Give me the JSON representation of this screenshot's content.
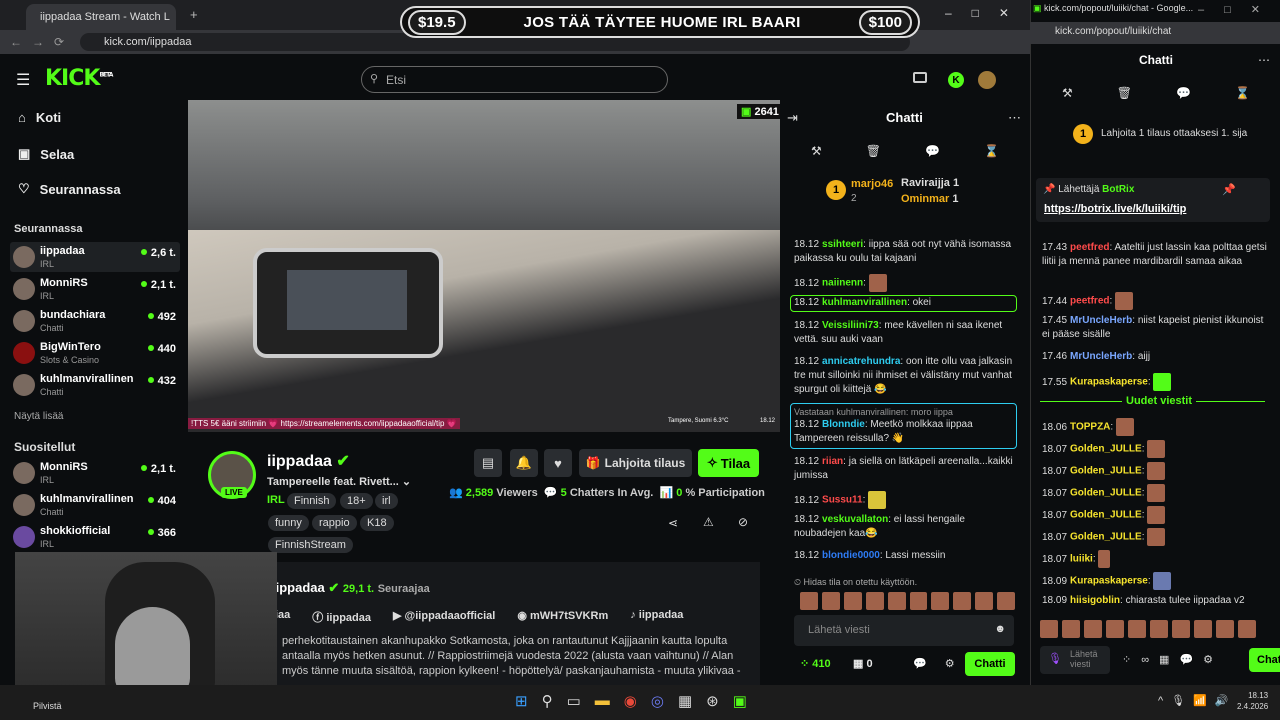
{
  "browser": {
    "tab_title": "iippadaa Stream - Watch L",
    "url": "kick.com/iippadaa",
    "popout_tab": "kick.com/popout/luiiki/chat - Google...",
    "popout_url": "kick.com/popout/luiiki/chat"
  },
  "banner": {
    "left": "$19.5",
    "text": "JOS TÄÄ TÄYTEE HUOME IRL BAARI",
    "right": "$100"
  },
  "logo": "KICK",
  "logo_beta": "BETA",
  "search": {
    "placeholder": "Etsi"
  },
  "nav": [
    {
      "label": "Koti"
    },
    {
      "label": "Selaa"
    },
    {
      "label": "Seurannassa"
    }
  ],
  "following_title": "Seurannassa",
  "following": [
    {
      "name": "iippadaa",
      "cat": "IRL",
      "viewers": "2,6 t."
    },
    {
      "name": "MonniRS",
      "cat": "IRL",
      "viewers": "2,1 t."
    },
    {
      "name": "bundachiara",
      "cat": "Chatti",
      "viewers": "492"
    },
    {
      "name": "BigWinTero",
      "cat": "Slots & Casino",
      "viewers": "440"
    },
    {
      "name": "kuhlmanvirallinen",
      "cat": "Chatti",
      "viewers": "432"
    }
  ],
  "show_all": "Näytä lisää",
  "recommended_title": "Suositellut",
  "recommended": [
    {
      "name": "MonniRS",
      "cat": "IRL",
      "viewers": "2,1 t."
    },
    {
      "name": "kuhlmanvirallinen",
      "cat": "Chatti",
      "viewers": "404"
    },
    {
      "name": "shokkiofficial",
      "cat": "IRL",
      "viewers": "366"
    }
  ],
  "video": {
    "viewers": "2641",
    "tts": "!TTS 5€ ääni striimiin 💗 https://streamelements.com/iippadaaofficial/tip 💗",
    "loc": "Tampere, Suomi  6.3°C",
    "time": "18.12"
  },
  "stream": {
    "name": "iippadaa",
    "title": "Tampereelle feat. Rivett...",
    "live": "LIVE",
    "category": "IRL",
    "tags": [
      "Finnish",
      "18+",
      "irl",
      "funny",
      "rappio",
      "K18",
      "FinnishStream"
    ],
    "gift": "Lahjoita tilaus",
    "sub": "Tilaa",
    "viewers": "2,589",
    "viewers_lbl": "Viewers",
    "chatters": "5",
    "chatters_lbl": "Chatters In Avg.",
    "part": "0",
    "part_lbl": "% Participation"
  },
  "about": {
    "name": "iippadaa",
    "followers": "29,1 t.",
    "followers_lbl": "Seuraajaa",
    "links": [
      "iaa",
      "iippadaa",
      "@iippadaaofficial",
      "mWH7tSVKRm",
      "iippadaa"
    ],
    "desc1": "perhekotitaustainen akanhupakko Sotkamosta, joka on rantautunut Kajjjaanin kautta lopulta",
    "desc2": "antaalla myös hetken asunut. // Rappiostriimejä vuodesta 2022 (alusta vaan vaihtunu) // Alan",
    "desc3": "myös tänne muuta sisältöä, rappion kylkeen! - höpöttelyä/ paskanjauhamista - muuta ylikivaa -"
  },
  "chat": {
    "title": "Chatti",
    "top": [
      {
        "rank": "1",
        "name": "marjo46",
        "n": "2"
      },
      {
        "name": "Raviraijja",
        "n": "1"
      },
      {
        "name": "Ominmar",
        "n": "1"
      }
    ],
    "messages": [
      {
        "t": "18.12",
        "u": "ssihteeri",
        "c": "#53fc18",
        "m": "iippa sää oot nyt vähä isomassa paikassa ku oulu tai kajaani"
      },
      {
        "t": "18.12",
        "u": "naiinenn",
        "c": "#53fc18",
        "m": ""
      },
      {
        "t": "18.12",
        "u": "kuhlmanvirallinen",
        "c": "#53fc18",
        "m": "okei"
      },
      {
        "t": "18.12",
        "u": "Veissiliini73",
        "c": "#53fc18",
        "m": "mee kävellen ni saa ikenet vettä. suu auki vaan"
      },
      {
        "t": "18.12",
        "u": "annicatrehundra",
        "c": "#2ecdf0",
        "m": "oon itte ollu vaa jalkasin tre mut silloinki nii ihmiset ei välistäny mut vanhat spurgut oli kiittejä 😂"
      },
      {
        "t": "18.12",
        "u": "Blonndie",
        "c": "#2ecdf0",
        "m": "Meetkö molkkaa iippaa Tampereen reissulla? 👋",
        "reply": "Vastataan kuhlmanvirallinen: moro iippa"
      },
      {
        "t": "18.12",
        "u": "riian",
        "c": "#ff4b4b",
        "m": "ja siellä on lätkäpeli areenalla...kaikki jumissa"
      },
      {
        "t": "18.12",
        "u": "Sussu11",
        "c": "#ff4b4b",
        "m": ""
      },
      {
        "t": "18.12",
        "u": "veskuvallaton",
        "c": "#53fc18",
        "m": "ei lassi hengaile noubadejen kaa😂"
      },
      {
        "t": "18.12",
        "u": "blondie0000",
        "c": "#2e7cf6",
        "m": "Lassi messiin"
      }
    ],
    "slow": "Hidas tila on otettu käyttöön.",
    "input": "Lähetä viesti",
    "points": "410",
    "gifts": "0",
    "send": "Chatti"
  },
  "popout": {
    "title": "Chatti",
    "gift_prompt": "Lahjoita 1 tilaus ottaaksesi 1. sija",
    "pinned_by": "Lähettäjä",
    "pinned_user": "BotRix",
    "pinned_link": "https://botrix.live/k/luiiki/tip",
    "messages": [
      {
        "t": "17.43",
        "u": "peetfred",
        "c": "#ff4b4b",
        "m": "Aateltii just lassin kaa polttaa getsi liitii ja mennä panee mardibardil samaa aikaa"
      },
      {
        "t": "17.44",
        "u": "peetfred",
        "c": "#ff4b4b",
        "m": ""
      },
      {
        "t": "17.45",
        "u": "MrUncleHerb",
        "c": "#7aa7ff",
        "m": "niist kapeist pienist ikkunoist ei pääse sisälle"
      },
      {
        "t": "17.46",
        "u": "MrUncleHerb",
        "c": "#7aa7ff",
        "m": "aijj"
      },
      {
        "t": "17.55",
        "u": "Kurapaskaperse",
        "c": "#f6e42e",
        "m": ""
      }
    ],
    "new_msgs": "Uudet viestit",
    "messages2": [
      {
        "t": "18.06",
        "u": "TOPPZA",
        "c": "#f6e42e",
        "m": ""
      },
      {
        "t": "18.07",
        "u": "Golden_JULLE",
        "c": "#f6e42e",
        "m": ""
      },
      {
        "t": "18.07",
        "u": "Golden_JULLE",
        "c": "#f6e42e",
        "m": ""
      },
      {
        "t": "18.07",
        "u": "Golden_JULLE",
        "c": "#f6e42e",
        "m": ""
      },
      {
        "t": "18.07",
        "u": "Golden_JULLE",
        "c": "#f6e42e",
        "m": ""
      },
      {
        "t": "18.07",
        "u": "Golden_JULLE",
        "c": "#f6e42e",
        "m": ""
      },
      {
        "t": "18.07",
        "u": "luiiki",
        "c": "#f6e42e",
        "m": ""
      },
      {
        "t": "18.09",
        "u": "Kurapaskaperse",
        "c": "#f6e42e",
        "m": ""
      },
      {
        "t": "18.09",
        "u": "hiisigoblin",
        "c": "#f6e42e",
        "m": "chiarasta tulee iippadaa v2"
      }
    ],
    "input": "Lähetä viesti",
    "send": "Chat"
  },
  "taskbar": {
    "weather": "Pilvistä",
    "time": "18.13",
    "date": "2.4.2026"
  }
}
